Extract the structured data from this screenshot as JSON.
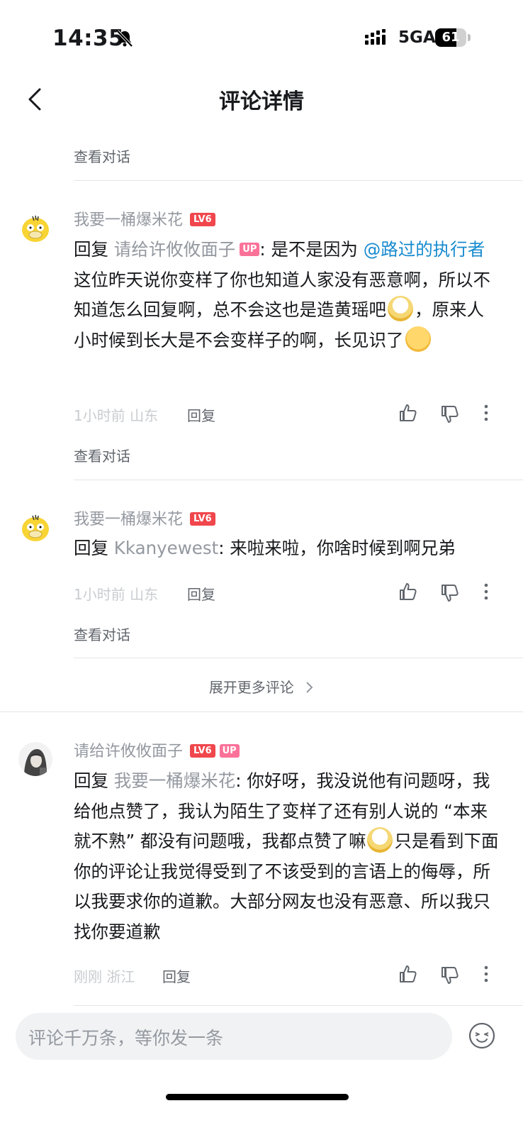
{
  "status": {
    "time": "14:35",
    "network": "5GA",
    "battery": "61"
  },
  "nav": {
    "title": "评论详情"
  },
  "top": {
    "view_dialog": "查看对话"
  },
  "comments": [
    {
      "username": "我要一桶爆米花",
      "level": "LV6",
      "reply_prefix": "回复 ",
      "reply_to": "请给许攸攸面子",
      "reply_to_badge": "UP",
      "text_1": ": 是不是因为 ",
      "mention": "@路过的执行者",
      "text_2": " 这位昨天说你变样了你也知道人家没有恶意啊，所以不知道怎么回复啊，总不会这也是造黄瑶吧",
      "text_3": "，原来人小时候到长大是不会变样子的啊，长见识了",
      "time": "1小时前",
      "location": "山东",
      "reply_label": "回复",
      "view_dialog": "查看对话"
    },
    {
      "username": "我要一桶爆米花",
      "level": "LV6",
      "reply_prefix": "回复 ",
      "reply_to": "Kkanyewest",
      "text_1": ": 来啦来啦，你啥时候到啊兄弟",
      "time": "1小时前",
      "location": "山东",
      "reply_label": "回复",
      "view_dialog": "查看对话"
    },
    {
      "username": "请给许攸攸面子",
      "level": "LV6",
      "badge": "UP",
      "reply_prefix": "回复 ",
      "reply_to": "我要一桶爆米花",
      "text_1": ": 你好呀，我没说他有问题呀，我给他点赞了，我认为陌生了变样了还有别人说的 “本来就不熟” 都没有问题哦，我都点赞了嘛",
      "text_2": "只是看到下面你的评论让我觉得受到了不该受到的言语上的侮辱，所以我要求你的道歉。大部分网友也没有恶意、所以我只找你要道歉",
      "time": "刚刚",
      "location": "浙江",
      "reply_label": "回复"
    }
  ],
  "expand_more": "展开更多评论",
  "input": {
    "placeholder": "评论千万条，等你发一条"
  },
  "colors": {
    "accent_pink": "#fb7299",
    "link_blue": "#178bcf",
    "gray_text": "#9499a0"
  }
}
